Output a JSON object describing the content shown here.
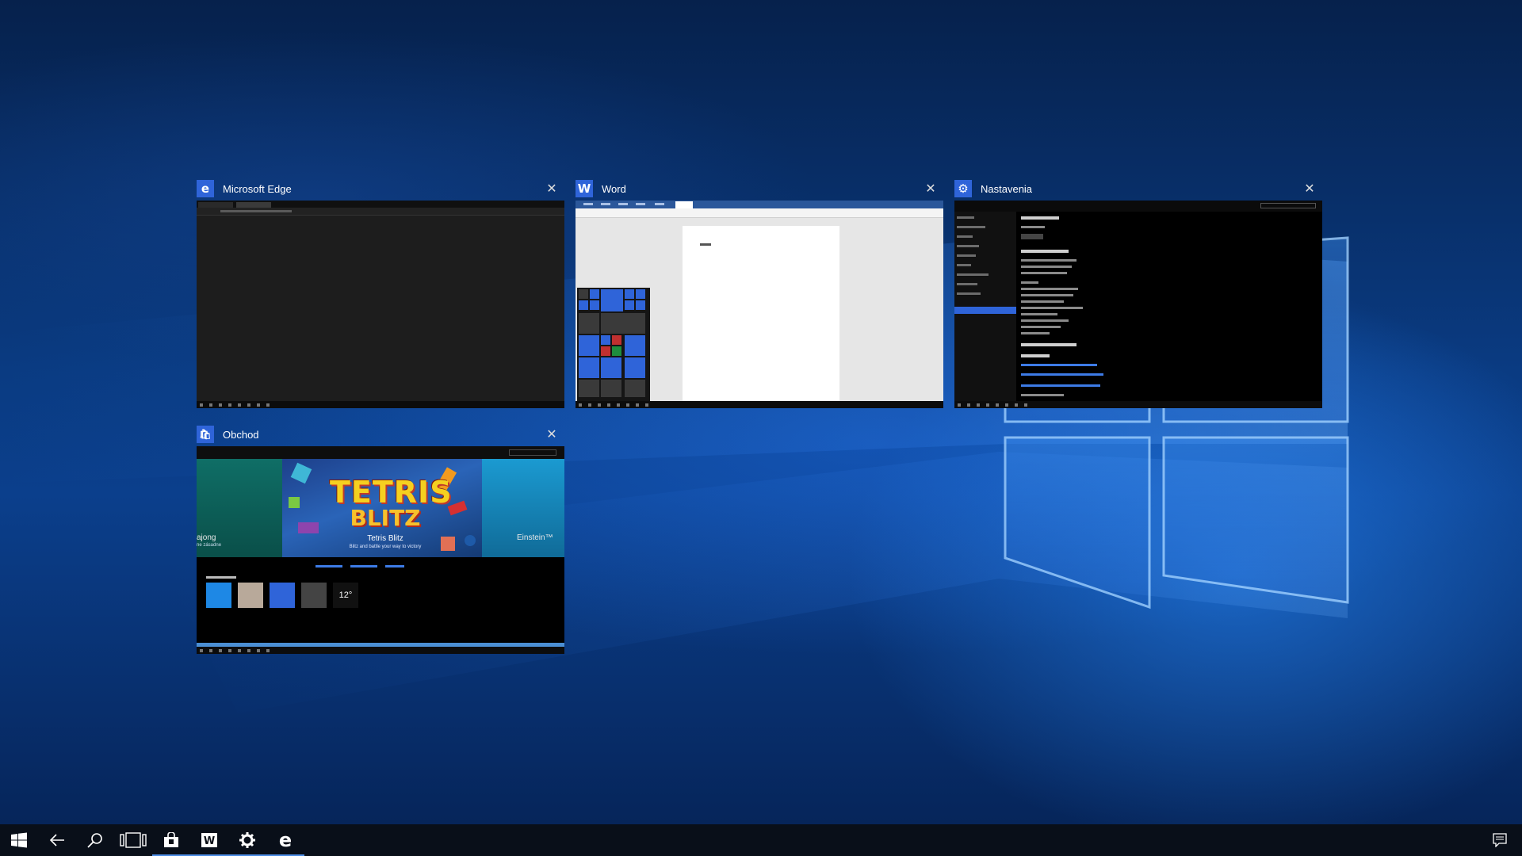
{
  "windows": [
    {
      "id": "edge",
      "title": "Microsoft Edge",
      "icon": "edge-icon",
      "icon_glyph": "e",
      "close": "✕"
    },
    {
      "id": "word",
      "title": "Word",
      "icon": "word-icon",
      "icon_glyph": "W",
      "close": "✕"
    },
    {
      "id": "settings",
      "title": "Nastavenia",
      "icon": "settings-gear-icon",
      "icon_glyph": "⚙",
      "close": "✕"
    },
    {
      "id": "store",
      "title": "Obchod",
      "icon": "store-icon",
      "icon_glyph": "🛍",
      "close": "✕"
    }
  ],
  "store": {
    "hero_title": "TETRIS",
    "hero_subtitle": "BLITZ",
    "hero_game_name": "Tetris Blitz",
    "hero_tagline": "Blitz and battle your way to victory",
    "hero_left_text": "ajong",
    "hero_left_subtext": "ne zásadne",
    "hero_right_text": "Einstein™",
    "weather_temp": "12°"
  },
  "taskbar": {
    "items": [
      {
        "name": "start-button",
        "glyph": "⊞",
        "active": false
      },
      {
        "name": "back-button",
        "glyph": "←",
        "active": false
      },
      {
        "name": "search-button",
        "glyph": "⌕",
        "active": false
      },
      {
        "name": "task-view-button",
        "glyph": "▭",
        "active": false
      },
      {
        "name": "taskbar-store",
        "glyph": "🛍",
        "active": true
      },
      {
        "name": "taskbar-word",
        "glyph": "W",
        "active": true
      },
      {
        "name": "taskbar-settings",
        "glyph": "⚙",
        "active": true
      },
      {
        "name": "taskbar-edge",
        "glyph": "e",
        "active": true
      }
    ],
    "action_center_glyph": "▤"
  },
  "colors": {
    "accent": "#2f64d9",
    "taskbar_indicator": "#4d8de6",
    "wallpaper_dark": "#06214c",
    "wallpaper_light": "#2a8cff"
  }
}
